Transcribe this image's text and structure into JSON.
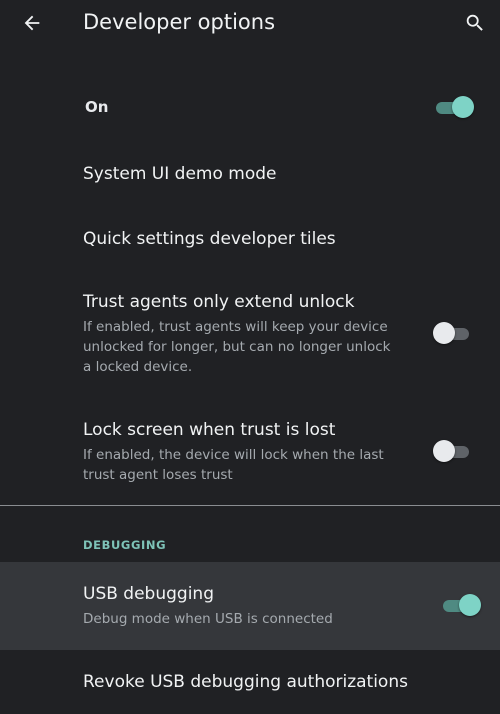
{
  "app_bar": {
    "title": "Developer options",
    "back_icon": "arrow-back-icon",
    "search_icon": "search-icon"
  },
  "master_switch": {
    "label": "On",
    "checked": true
  },
  "items": [
    {
      "title": "System UI demo mode"
    },
    {
      "title": "Quick settings developer tiles"
    },
    {
      "title": "Trust agents only extend unlock",
      "summary": "If enabled, trust agents will keep your device unlocked for longer, but can no longer unlock a locked device.",
      "checked": false
    },
    {
      "title": "Lock screen when trust is lost",
      "summary": "If enabled, the device will lock when the last trust agent loses trust",
      "checked": false
    }
  ],
  "debugging": {
    "header": "DEBUGGING",
    "items": [
      {
        "title": "USB debugging",
        "summary": "Debug mode when USB is connected",
        "checked": true
      },
      {
        "title": "Revoke USB debugging authorizations"
      }
    ]
  },
  "colors": {
    "background": "#202124",
    "accent": "#7ed3c6",
    "section_header": "#7ec3b8",
    "highlight": "#35373b"
  }
}
